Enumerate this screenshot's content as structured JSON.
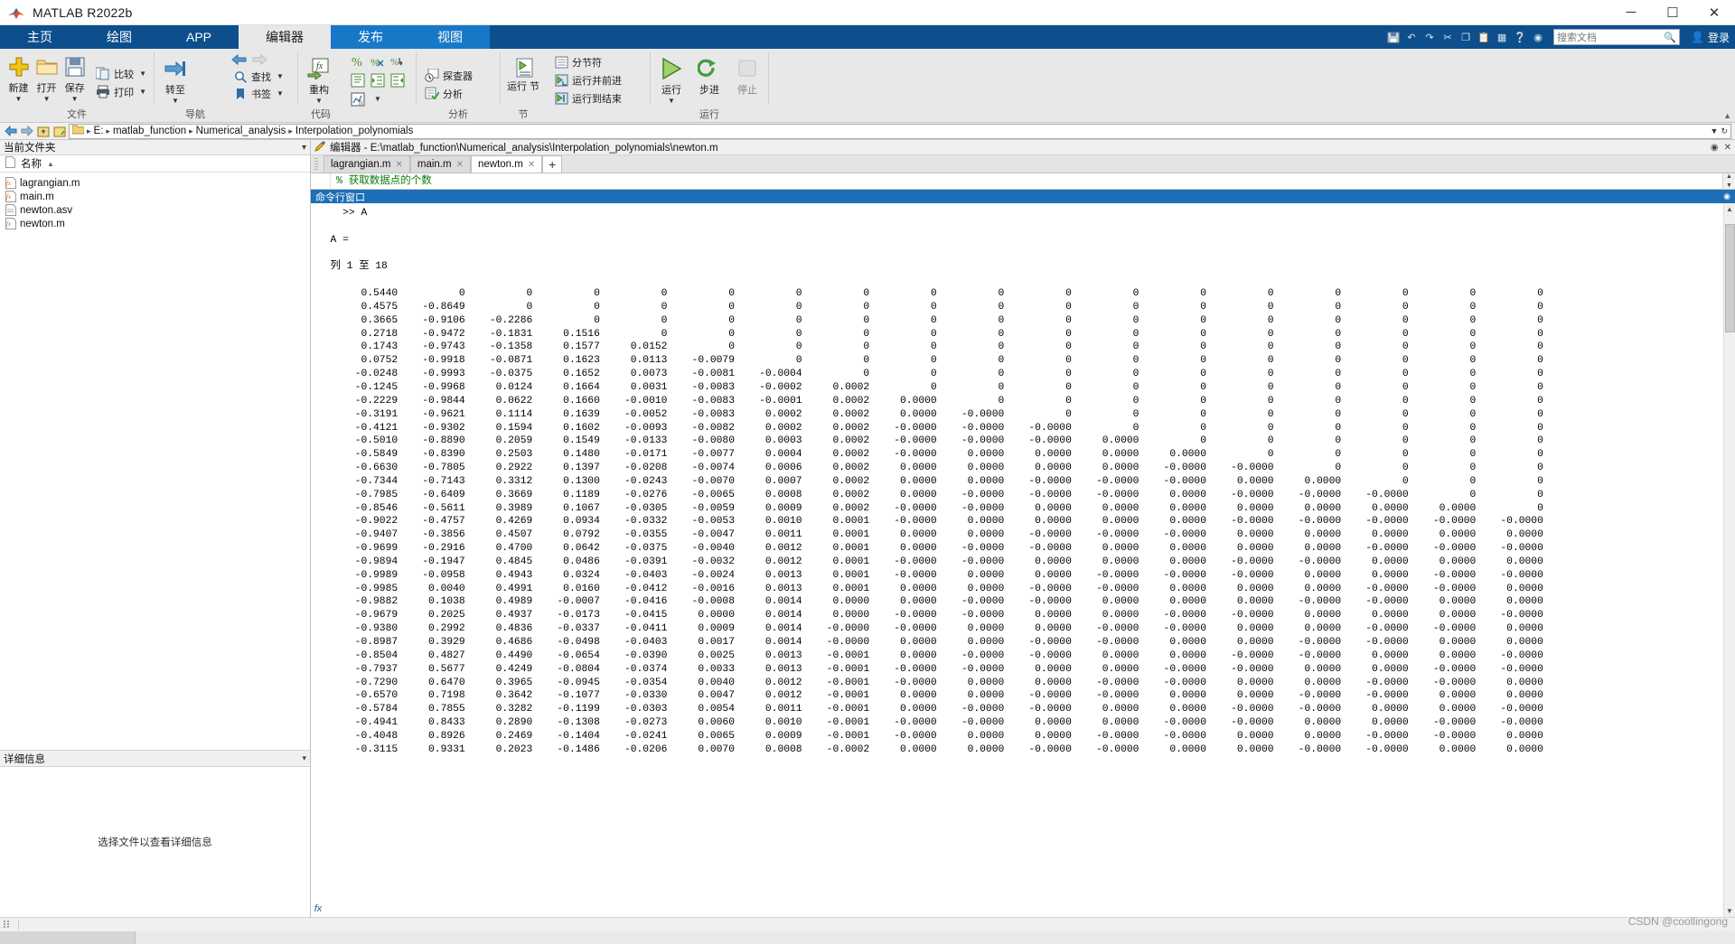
{
  "window": {
    "title": "MATLAB R2022b",
    "minimize": "─",
    "maximize": "☐",
    "close": "✕"
  },
  "ribbon_tabs": [
    {
      "label": "主页",
      "state": "normal"
    },
    {
      "label": "绘图",
      "state": "normal"
    },
    {
      "label": "APP",
      "state": "normal"
    },
    {
      "label": "编辑器",
      "state": "active"
    },
    {
      "label": "发布",
      "state": "highlight"
    },
    {
      "label": "视图",
      "state": "highlight"
    }
  ],
  "quick_access": {
    "search_placeholder": "搜索文档",
    "sign_in": "登录"
  },
  "ribbon_groups": [
    {
      "label": "文件",
      "big_buttons": [
        {
          "label": "新建",
          "icon": "new-file-icon",
          "dropdown": true
        },
        {
          "label": "打开",
          "icon": "open-folder-icon",
          "dropdown": true
        },
        {
          "label": "保存",
          "icon": "save-disk-icon",
          "dropdown": true
        }
      ],
      "small_buttons": [
        {
          "label": "比较",
          "icon": "compare-icon",
          "dropdown": true
        },
        {
          "label": "打印",
          "icon": "print-icon",
          "dropdown": true
        }
      ]
    },
    {
      "label": "导航",
      "big_buttons": [
        {
          "label": "转至",
          "icon": "goto-icon",
          "dropdown": true
        }
      ],
      "small_buttons": [
        {
          "label": "查找",
          "icon": "search-icon",
          "dropdown": true
        },
        {
          "label": "书签",
          "icon": "bookmark-icon",
          "dropdown": true
        }
      ],
      "nav_arrows": [
        "back-arrow-icon",
        "forward-arrow-icon"
      ]
    },
    {
      "label": "代码",
      "big_buttons": [
        {
          "label": "重构",
          "icon": "refactor-fx-icon",
          "dropdown": true
        }
      ],
      "icon_rows": [
        [
          "comment-percent-icon",
          "uncomment-icon",
          "wrap-comment-icon"
        ],
        [
          "smart-indent-icon",
          "indent-right-icon",
          "indent-left-icon"
        ],
        [
          "insert-function-icon"
        ]
      ]
    },
    {
      "label": "分析",
      "small_buttons": [
        {
          "label": "探查器",
          "icon": "profiler-clock-icon",
          "dropdown": false
        },
        {
          "label": "分析",
          "icon": "analyze-check-icon",
          "dropdown": false
        }
      ]
    },
    {
      "label": "节",
      "big_buttons": [
        {
          "label": "运行\n节",
          "icon": "run-section-icon",
          "dropdown": false
        }
      ],
      "small_buttons": [
        {
          "label": "分节符",
          "icon": "section-break-icon",
          "dropdown": false
        },
        {
          "label": "运行并前进",
          "icon": "run-advance-icon",
          "dropdown": false
        },
        {
          "label": "运行到结束",
          "icon": "run-to-end-icon",
          "dropdown": false
        }
      ]
    },
    {
      "label": "运行",
      "big_buttons": [
        {
          "label": "运行",
          "icon": "run-play-icon",
          "dropdown": true
        },
        {
          "label": "步进",
          "icon": "step-icon",
          "dropdown": false
        },
        {
          "label": "停止",
          "icon": "stop-icon",
          "dropdown": false
        }
      ]
    }
  ],
  "address_bar": {
    "crumbs": [
      "E:",
      "matlab_function",
      "Numerical_analysis",
      "Interpolation_polynomials"
    ],
    "separator": "▸",
    "folder_icon": "folder-icon",
    "back": "←",
    "forward": "→",
    "up": "up-folder-icon",
    "browse": "browse-folder-icon"
  },
  "current_folder_panel": {
    "title": "当前文件夹",
    "column_header": "名称",
    "sort_arrow": "▲",
    "files": [
      {
        "name": "lagrangian.m",
        "icon": "m-file-icon"
      },
      {
        "name": "main.m",
        "icon": "m-file-icon"
      },
      {
        "name": "newton.asv",
        "icon": "asv-file-icon"
      },
      {
        "name": "newton.m",
        "icon": "m-file-icon"
      }
    ],
    "details_title": "详细信息",
    "details_empty": "选择文件以查看详细信息"
  },
  "editor_panel": {
    "title": "编辑器 - E:\\matlab_function\\Numerical_analysis\\Interpolation_polynomials\\newton.m",
    "tabs": [
      {
        "label": "lagrangian.m",
        "active": false
      },
      {
        "label": "main.m",
        "active": false
      },
      {
        "label": "newton.m",
        "active": true
      }
    ],
    "add_tab": "+",
    "visible_code_line": "% 获取数据点的个数"
  },
  "command_window": {
    "title": "命令行窗口",
    "prompt": ">> A",
    "variable_line": "A =",
    "columns_label": "列 1 至 18",
    "matrix_rows": [
      [
        "0.5440",
        "0",
        "0",
        "0",
        "0",
        "0",
        "0",
        "0",
        "0",
        "0",
        "0",
        "0",
        "0",
        "0",
        "0",
        "0",
        "0",
        "0"
      ],
      [
        "0.4575",
        "-0.8649",
        "0",
        "0",
        "0",
        "0",
        "0",
        "0",
        "0",
        "0",
        "0",
        "0",
        "0",
        "0",
        "0",
        "0",
        "0",
        "0"
      ],
      [
        "0.3665",
        "-0.9106",
        "-0.2286",
        "0",
        "0",
        "0",
        "0",
        "0",
        "0",
        "0",
        "0",
        "0",
        "0",
        "0",
        "0",
        "0",
        "0",
        "0"
      ],
      [
        "0.2718",
        "-0.9472",
        "-0.1831",
        "0.1516",
        "0",
        "0",
        "0",
        "0",
        "0",
        "0",
        "0",
        "0",
        "0",
        "0",
        "0",
        "0",
        "0",
        "0"
      ],
      [
        "0.1743",
        "-0.9743",
        "-0.1358",
        "0.1577",
        "0.0152",
        "0",
        "0",
        "0",
        "0",
        "0",
        "0",
        "0",
        "0",
        "0",
        "0",
        "0",
        "0",
        "0"
      ],
      [
        "0.0752",
        "-0.9918",
        "-0.0871",
        "0.1623",
        "0.0113",
        "-0.0079",
        "0",
        "0",
        "0",
        "0",
        "0",
        "0",
        "0",
        "0",
        "0",
        "0",
        "0",
        "0"
      ],
      [
        "-0.0248",
        "-0.9993",
        "-0.0375",
        "0.1652",
        "0.0073",
        "-0.0081",
        "-0.0004",
        "0",
        "0",
        "0",
        "0",
        "0",
        "0",
        "0",
        "0",
        "0",
        "0",
        "0"
      ],
      [
        "-0.1245",
        "-0.9968",
        "0.0124",
        "0.1664",
        "0.0031",
        "-0.0083",
        "-0.0002",
        "0.0002",
        "0",
        "0",
        "0",
        "0",
        "0",
        "0",
        "0",
        "0",
        "0",
        "0"
      ],
      [
        "-0.2229",
        "-0.9844",
        "0.0622",
        "0.1660",
        "-0.0010",
        "-0.0083",
        "-0.0001",
        "0.0002",
        "0.0000",
        "0",
        "0",
        "0",
        "0",
        "0",
        "0",
        "0",
        "0",
        "0"
      ],
      [
        "-0.3191",
        "-0.9621",
        "0.1114",
        "0.1639",
        "-0.0052",
        "-0.0083",
        "0.0002",
        "0.0002",
        "0.0000",
        "-0.0000",
        "0",
        "0",
        "0",
        "0",
        "0",
        "0",
        "0",
        "0"
      ],
      [
        "-0.4121",
        "-0.9302",
        "0.1594",
        "0.1602",
        "-0.0093",
        "-0.0082",
        "0.0002",
        "0.0002",
        "-0.0000",
        "-0.0000",
        "-0.0000",
        "0",
        "0",
        "0",
        "0",
        "0",
        "0",
        "0"
      ],
      [
        "-0.5010",
        "-0.8890",
        "0.2059",
        "0.1549",
        "-0.0133",
        "-0.0080",
        "0.0003",
        "0.0002",
        "-0.0000",
        "-0.0000",
        "-0.0000",
        "0.0000",
        "0",
        "0",
        "0",
        "0",
        "0",
        "0"
      ],
      [
        "-0.5849",
        "-0.8390",
        "0.2503",
        "0.1480",
        "-0.0171",
        "-0.0077",
        "0.0004",
        "0.0002",
        "-0.0000",
        "0.0000",
        "0.0000",
        "0.0000",
        "0.0000",
        "0",
        "0",
        "0",
        "0",
        "0"
      ],
      [
        "-0.6630",
        "-0.7805",
        "0.2922",
        "0.1397",
        "-0.0208",
        "-0.0074",
        "0.0006",
        "0.0002",
        "0.0000",
        "0.0000",
        "0.0000",
        "0.0000",
        "-0.0000",
        "-0.0000",
        "0",
        "0",
        "0",
        "0"
      ],
      [
        "-0.7344",
        "-0.7143",
        "0.3312",
        "0.1300",
        "-0.0243",
        "-0.0070",
        "0.0007",
        "0.0002",
        "0.0000",
        "0.0000",
        "-0.0000",
        "-0.0000",
        "-0.0000",
        "0.0000",
        "0.0000",
        "0",
        "0",
        "0"
      ],
      [
        "-0.7985",
        "-0.6409",
        "0.3669",
        "0.1189",
        "-0.0276",
        "-0.0065",
        "0.0008",
        "0.0002",
        "0.0000",
        "-0.0000",
        "-0.0000",
        "-0.0000",
        "0.0000",
        "-0.0000",
        "-0.0000",
        "-0.0000",
        "0",
        "0"
      ],
      [
        "-0.8546",
        "-0.5611",
        "0.3989",
        "0.1067",
        "-0.0305",
        "-0.0059",
        "0.0009",
        "0.0002",
        "-0.0000",
        "-0.0000",
        "0.0000",
        "0.0000",
        "0.0000",
        "0.0000",
        "0.0000",
        "0.0000",
        "0.0000",
        "0"
      ],
      [
        "-0.9022",
        "-0.4757",
        "0.4269",
        "0.0934",
        "-0.0332",
        "-0.0053",
        "0.0010",
        "0.0001",
        "-0.0000",
        "0.0000",
        "0.0000",
        "0.0000",
        "0.0000",
        "-0.0000",
        "-0.0000",
        "-0.0000",
        "-0.0000",
        "-0.0000"
      ],
      [
        "-0.9407",
        "-0.3856",
        "0.4507",
        "0.0792",
        "-0.0355",
        "-0.0047",
        "0.0011",
        "0.0001",
        "0.0000",
        "0.0000",
        "-0.0000",
        "-0.0000",
        "-0.0000",
        "0.0000",
        "0.0000",
        "0.0000",
        "0.0000",
        "0.0000"
      ],
      [
        "-0.9699",
        "-0.2916",
        "0.4700",
        "0.0642",
        "-0.0375",
        "-0.0040",
        "0.0012",
        "0.0001",
        "0.0000",
        "-0.0000",
        "-0.0000",
        "0.0000",
        "0.0000",
        "0.0000",
        "0.0000",
        "-0.0000",
        "-0.0000",
        "-0.0000"
      ],
      [
        "-0.9894",
        "-0.1947",
        "0.4845",
        "0.0486",
        "-0.0391",
        "-0.0032",
        "0.0012",
        "0.0001",
        "-0.0000",
        "-0.0000",
        "0.0000",
        "0.0000",
        "0.0000",
        "-0.0000",
        "-0.0000",
        "0.0000",
        "0.0000",
        "0.0000"
      ],
      [
        "-0.9989",
        "-0.0958",
        "0.4943",
        "0.0324",
        "-0.0403",
        "-0.0024",
        "0.0013",
        "0.0001",
        "-0.0000",
        "0.0000",
        "0.0000",
        "-0.0000",
        "-0.0000",
        "-0.0000",
        "0.0000",
        "0.0000",
        "-0.0000",
        "-0.0000"
      ],
      [
        "-0.9985",
        "0.0040",
        "0.4991",
        "0.0160",
        "-0.0412",
        "-0.0016",
        "0.0013",
        "0.0001",
        "0.0000",
        "0.0000",
        "-0.0000",
        "-0.0000",
        "0.0000",
        "0.0000",
        "0.0000",
        "-0.0000",
        "-0.0000",
        "0.0000"
      ],
      [
        "-0.9882",
        "0.1038",
        "0.4989",
        "-0.0007",
        "-0.0416",
        "-0.0008",
        "0.0014",
        "0.0000",
        "0.0000",
        "-0.0000",
        "-0.0000",
        "0.0000",
        "0.0000",
        "0.0000",
        "-0.0000",
        "-0.0000",
        "0.0000",
        "0.0000"
      ],
      [
        "-0.9679",
        "0.2025",
        "0.4937",
        "-0.0173",
        "-0.0415",
        "0.0000",
        "0.0014",
        "0.0000",
        "-0.0000",
        "-0.0000",
        "0.0000",
        "0.0000",
        "-0.0000",
        "-0.0000",
        "0.0000",
        "0.0000",
        "0.0000",
        "-0.0000"
      ],
      [
        "-0.9380",
        "0.2992",
        "0.4836",
        "-0.0337",
        "-0.0411",
        "0.0009",
        "0.0014",
        "-0.0000",
        "-0.0000",
        "0.0000",
        "0.0000",
        "-0.0000",
        "-0.0000",
        "0.0000",
        "0.0000",
        "-0.0000",
        "-0.0000",
        "0.0000"
      ],
      [
        "-0.8987",
        "0.3929",
        "0.4686",
        "-0.0498",
        "-0.0403",
        "0.0017",
        "0.0014",
        "-0.0000",
        "0.0000",
        "0.0000",
        "-0.0000",
        "-0.0000",
        "0.0000",
        "0.0000",
        "-0.0000",
        "-0.0000",
        "0.0000",
        "0.0000"
      ],
      [
        "-0.8504",
        "0.4827",
        "0.4490",
        "-0.0654",
        "-0.0390",
        "0.0025",
        "0.0013",
        "-0.0001",
        "0.0000",
        "-0.0000",
        "-0.0000",
        "0.0000",
        "0.0000",
        "-0.0000",
        "-0.0000",
        "0.0000",
        "0.0000",
        "-0.0000"
      ],
      [
        "-0.7937",
        "0.5677",
        "0.4249",
        "-0.0804",
        "-0.0374",
        "0.0033",
        "0.0013",
        "-0.0001",
        "-0.0000",
        "-0.0000",
        "0.0000",
        "0.0000",
        "-0.0000",
        "-0.0000",
        "0.0000",
        "0.0000",
        "-0.0000",
        "-0.0000"
      ],
      [
        "-0.7290",
        "0.6470",
        "0.3965",
        "-0.0945",
        "-0.0354",
        "0.0040",
        "0.0012",
        "-0.0001",
        "-0.0000",
        "0.0000",
        "0.0000",
        "-0.0000",
        "-0.0000",
        "0.0000",
        "0.0000",
        "-0.0000",
        "-0.0000",
        "0.0000"
      ],
      [
        "-0.6570",
        "0.7198",
        "0.3642",
        "-0.1077",
        "-0.0330",
        "0.0047",
        "0.0012",
        "-0.0001",
        "0.0000",
        "0.0000",
        "-0.0000",
        "-0.0000",
        "0.0000",
        "0.0000",
        "-0.0000",
        "-0.0000",
        "0.0000",
        "0.0000"
      ],
      [
        "-0.5784",
        "0.7855",
        "0.3282",
        "-0.1199",
        "-0.0303",
        "0.0054",
        "0.0011",
        "-0.0001",
        "0.0000",
        "-0.0000",
        "-0.0000",
        "0.0000",
        "0.0000",
        "-0.0000",
        "-0.0000",
        "0.0000",
        "0.0000",
        "-0.0000"
      ],
      [
        "-0.4941",
        "0.8433",
        "0.2890",
        "-0.1308",
        "-0.0273",
        "0.0060",
        "0.0010",
        "-0.0001",
        "-0.0000",
        "-0.0000",
        "0.0000",
        "0.0000",
        "-0.0000",
        "-0.0000",
        "0.0000",
        "0.0000",
        "-0.0000",
        "-0.0000"
      ],
      [
        "-0.4048",
        "0.8926",
        "0.2469",
        "-0.1404",
        "-0.0241",
        "0.0065",
        "0.0009",
        "-0.0001",
        "-0.0000",
        "0.0000",
        "0.0000",
        "-0.0000",
        "-0.0000",
        "0.0000",
        "0.0000",
        "-0.0000",
        "-0.0000",
        "0.0000"
      ],
      [
        "-0.3115",
        "0.9331",
        "0.2023",
        "-0.1486",
        "-0.0206",
        "0.0070",
        "0.0008",
        "-0.0002",
        "0.0000",
        "0.0000",
        "-0.0000",
        "-0.0000",
        "0.0000",
        "0.0000",
        "-0.0000",
        "-0.0000",
        "0.0000",
        "0.0000"
      ]
    ],
    "fx_prompt": "fx"
  },
  "status_bar": {
    "watermark": "CSDN @coollingong"
  },
  "colors": {
    "ribbon_blue": "#0c4f8c",
    "tab_highlight": "#1878c8",
    "cw_header": "#1d6fb8",
    "panel_bg": "#e8e8e8",
    "accent_orange": "#d98c1a"
  }
}
